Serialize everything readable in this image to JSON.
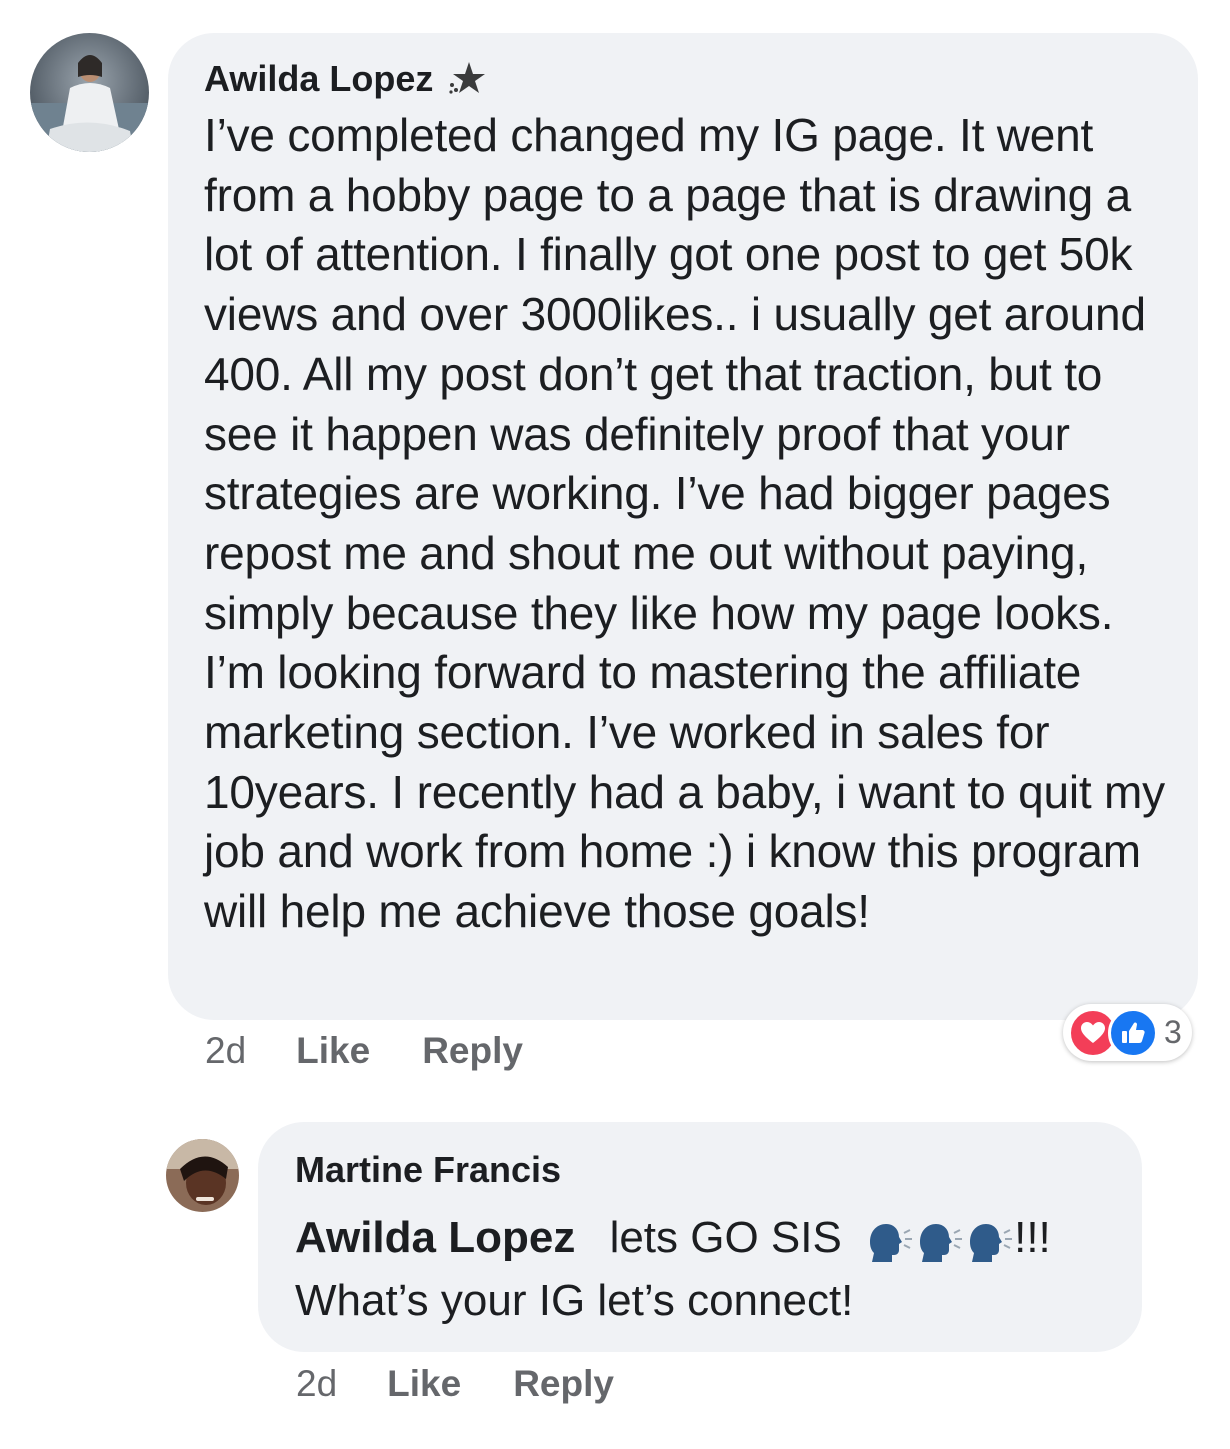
{
  "comments": [
    {
      "author": "Awilda Lopez",
      "badge_icon": "top-fan-star-icon",
      "text": "I’ve completed changed my IG page. It went from a hobby page to a page that is drawing a lot of attention. I finally got one post to get 50k views and over 3000likes.. i usually get around 400. All my post don’t get that traction, but to see it happen was definitely proof that your strategies are working. I’ve had bigger pages repost me and shout me out without paying, simply because they like how my page looks. I’m looking forward to mastering the affiliate marketing section. I’ve worked in sales for 10years. I recently had a baby, i want to quit my job and work from home :) i know this program will help me achieve those goals!",
      "time": "2d",
      "like_label": "Like",
      "reply_label": "Reply",
      "reaction_count": "3",
      "reaction_icons": [
        "love-icon",
        "like-icon"
      ],
      "colors": {
        "love": "#f33e58",
        "like": "#1877f2"
      }
    },
    {
      "author": "Martine Francis",
      "mention": "Awilda Lopez",
      "text_part1": "lets GO SIS",
      "emoji": "speaking-head-icon",
      "text_part2": "!!!",
      "text_line2": "What’s your IG let’s connect!",
      "time": "2d",
      "like_label": "Like",
      "reply_label": "Reply"
    }
  ],
  "colors": {
    "bubble": "#f0f2f5",
    "meta_text": "#65676b",
    "text": "#1c1e21"
  }
}
